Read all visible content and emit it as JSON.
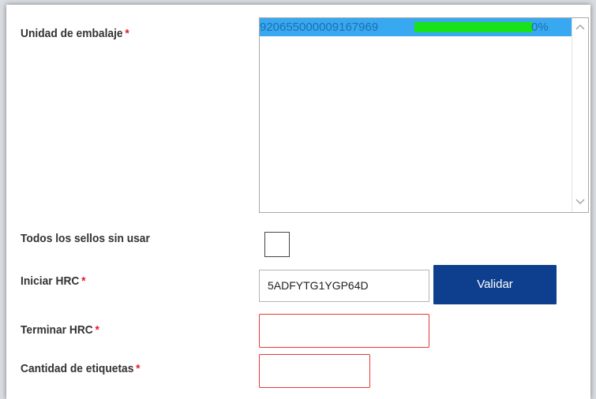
{
  "form": {
    "packaging_unit": {
      "label": "Unidad de embalaje",
      "required_mark": "*",
      "items": [
        {
          "code": "920655000009167969",
          "progress_fraction": 0.85,
          "progress_text": "0%",
          "selected": true
        }
      ]
    },
    "all_seals_unused": {
      "label": "Todos los sellos sin usar",
      "checked": false
    },
    "start_hrc": {
      "label": "Iniciar HRC",
      "required_mark": "*",
      "value": "5ADFYTG1YGP64D"
    },
    "validate_button": {
      "label": "Validar"
    },
    "end_hrc": {
      "label": "Terminar HRC",
      "required_mark": "*",
      "value": ""
    },
    "label_quantity": {
      "label": "Cantidad de etiquetas",
      "required_mark": "*",
      "value": ""
    }
  },
  "colors": {
    "selection": "#38a9f0",
    "progress": "#19e219",
    "button": "#0e3f8e",
    "required": "#e11d2a",
    "error_border": "#e53935"
  },
  "icons": {
    "scroll_up": "chevron-up-icon",
    "scroll_down": "chevron-down-icon"
  }
}
